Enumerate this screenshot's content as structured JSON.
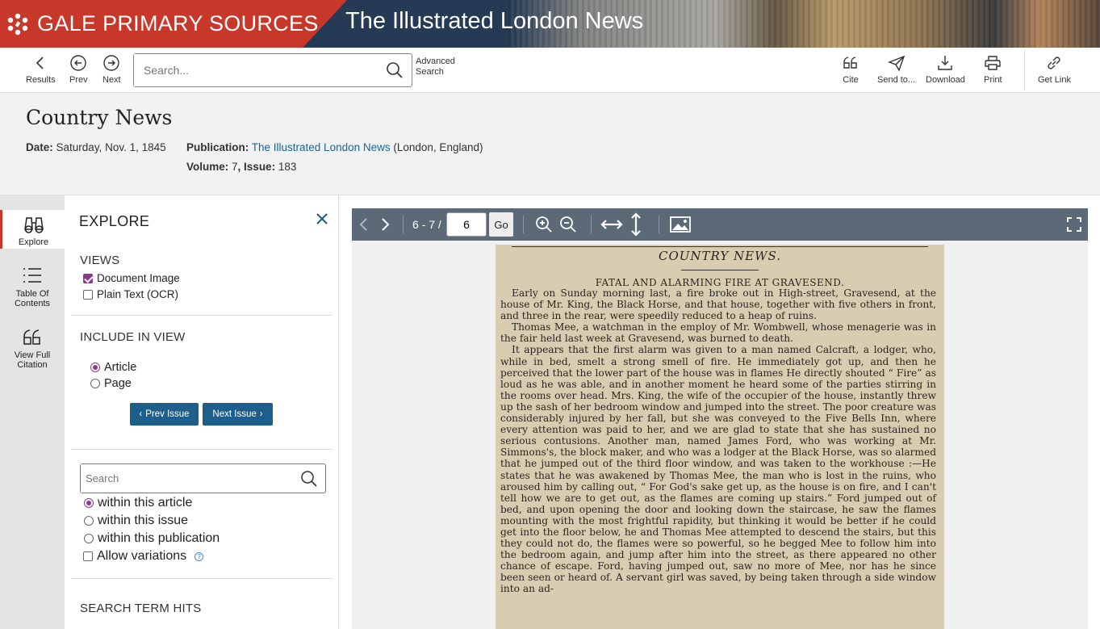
{
  "banner": {
    "brand": "GALE PRIMARY SOURCES",
    "publication": "The Illustrated London News"
  },
  "toolbar": {
    "results": "Results",
    "prev": "Prev",
    "next": "Next",
    "search_placeholder": "Search...",
    "advanced_line1": "Advanced",
    "advanced_line2": "Search",
    "cite": "Cite",
    "send_to": "Send to...",
    "download": "Download",
    "print": "Print",
    "get_link": "Get Link"
  },
  "document": {
    "title": "Country News",
    "date_label": "Date:",
    "date_value": "Saturday,  Nov. 1, 1845",
    "publication_label": "Publication:",
    "publication_link": "The Illustrated London News",
    "publication_place": "(London, England)",
    "volume_label": "Volume:",
    "volume_value": "7",
    "issue_label": ", Issue:",
    "issue_value": "183"
  },
  "rail": {
    "explore": "Explore",
    "toc_line1": "Table Of",
    "toc_line2": "Contents",
    "citation_line1": "View Full",
    "citation_line2": "Citation"
  },
  "explore": {
    "title": "EXPLORE",
    "views_heading": "VIEWS",
    "view_document_image": "Document Image",
    "view_plain_text": "Plain Text (OCR)",
    "include_heading": "INCLUDE IN VIEW",
    "include_article": "Article",
    "include_page": "Page",
    "prev_issue": "Prev Issue",
    "next_issue": "Next Issue",
    "search_placeholder": "Search",
    "within_article": "within this article",
    "within_issue": "within this issue",
    "within_publication": "within this publication",
    "allow_variations": "Allow variations",
    "hits_heading": "SEARCH TERM HITS",
    "help_symbol": "?"
  },
  "viewer": {
    "page_range": "6 - 7 /",
    "page_input": "6",
    "go": "Go",
    "newspaper": {
      "section": "COUNTRY NEWS.",
      "headline": "FATAL AND ALARMING FIRE AT GRAVESEND.",
      "paragraphs": [
        "Early on Sunday morning last, a fire broke out in High-street, Gravesend, at the house of Mr. King, the Black Horse, and that house, together with five others in front, and three in the rear, were speedily reduced to a heap of ruins.",
        "Thomas Mee, a watchman in the employ of Mr. Wombwell, whose menagerie was in the fair held last week at Gravesend, was burned to death.",
        "It appears that the first alarm was given to a man named Calcraft, a lodger, who, while in bed, smelt a strong smell of fire. He immediately got up, and then he perceived that the lower part of the house was in flames He directly shouted “ Fire” as loud as he was able, and in another moment he heard some of the parties stirring in the rooms over head. Mrs. King, the wife of the occupier of the house, instantly threw up the sash of her bedroom window and jumped into the street. The poor creature was considerably injured by her fall, but she was conveyed to the Five Bells Inn, where every attention was paid to her, and we are glad to state that she has sustained no serious contusions. Another man, named James Ford, who was working at Mr. Simmons's, the block maker, and who was a lodger at the Black Horse, was so alarmed that he jumped out of the third floor window, and was taken to the workhouse :—He states that he was awakened by Thomas Mee, the man who is lost in the ruins, who aroused him by calling out, “ For God's sake get up, as the house is on fire, and I can't tell how we are to get out, as the flames are coming up stairs.” Ford jumped out of bed, and upon opening the door and looking down the staircase, he saw the flames mounting with the most frightful rapidity, but thinking it would be better if he could get into the floor below, he and Thomas Mee attempted to descend the stairs, but this they could not do, the flames were so powerful, so he begged Mee to follow him into the bedroom again, and jump after him into the street, as there appeared no other chance of escape. Ford, having jumped out, saw no more of Mee, nor has he since been seen or heard of. A servant girl was saved, by being taken through a side window into an ad-"
      ]
    }
  },
  "colors": {
    "brand_red": "#c8382a",
    "navy": "#243a55",
    "link_blue": "#1a6496",
    "button_blue": "#1d5f8a",
    "viewer_bar": "#5c6a78",
    "check_purple": "#8b3a8b"
  }
}
